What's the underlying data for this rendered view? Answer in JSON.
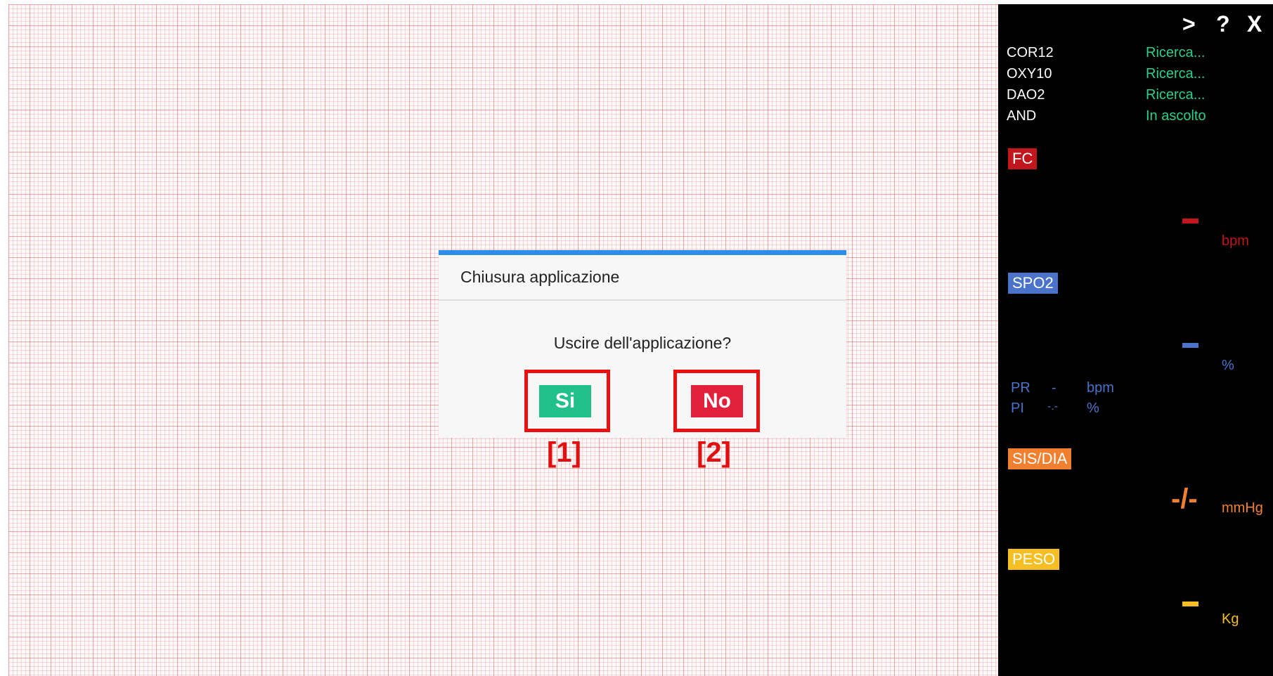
{
  "top_controls": {
    "next": ">",
    "help": "?",
    "close": "X"
  },
  "devices": [
    {
      "name": "COR12",
      "status": "Ricerca..."
    },
    {
      "name": "OXY10",
      "status": "Ricerca..."
    },
    {
      "name": "DAO2",
      "status": "Ricerca..."
    },
    {
      "name": "AND",
      "status": "In ascolto"
    }
  ],
  "vitals": {
    "fc": {
      "label": "FC",
      "unit": "bpm",
      "color": "#c0161c"
    },
    "spo2": {
      "label": "SPO2",
      "unit": "%",
      "color": "#4a73c9",
      "pr_label": "PR",
      "pr_value": "-",
      "pr_unit": "bpm",
      "pi_label": "PI",
      "pi_value": "-.-",
      "pi_unit": "%"
    },
    "sisdia": {
      "label": "SIS/DIA",
      "value": "-/-",
      "unit": "mmHg",
      "color": "#f08030"
    },
    "peso": {
      "label": "PESO",
      "unit": "Kg",
      "color": "#f5be22"
    }
  },
  "dialog": {
    "title": "Chiusura applicazione",
    "message": "Uscire dell'applicazione?",
    "yes_label": "Si",
    "no_label": "No",
    "accent": "#2b8ee8",
    "yes_color": "#22c08a",
    "no_color": "#e3203c"
  },
  "annotations": {
    "yes_marker": "[1]",
    "no_marker": "[2]"
  }
}
